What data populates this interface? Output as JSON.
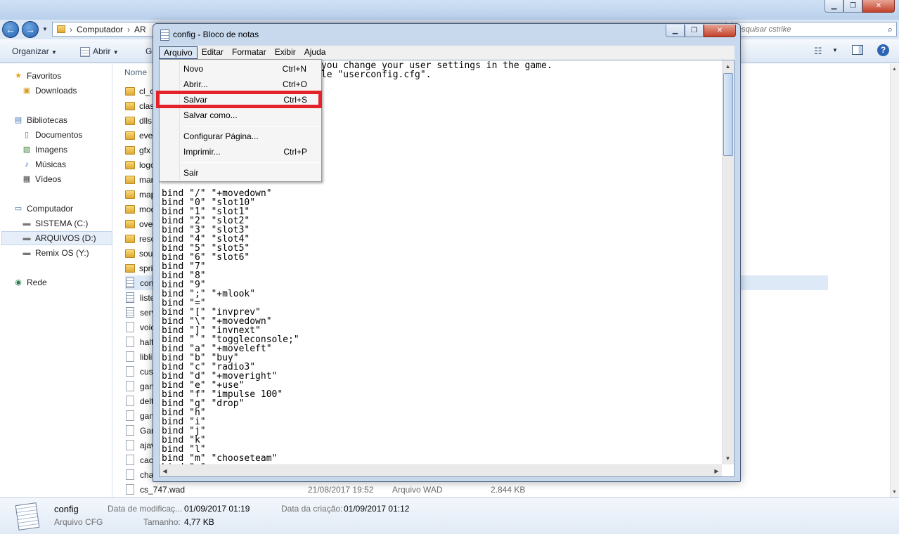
{
  "explorer": {
    "address": {
      "segments": [
        "Computador",
        "AR"
      ]
    },
    "search": {
      "placeholder": "esquisar cstrike"
    },
    "toolbar": {
      "organize": "Organizar",
      "open": "Abrir",
      "gr": "Gr"
    },
    "column_name": "Nome",
    "nav": {
      "favorites": "Favoritos",
      "downloads": "Downloads",
      "libraries": "Bibliotecas",
      "documents": "Documentos",
      "images": "Imagens",
      "music": "Músicas",
      "videos": "Vídeos",
      "computer": "Computador",
      "drive_c": "SISTEMA (C:)",
      "drive_d": "ARQUIVOS (D:)",
      "drive_y": "Remix OS (Y:)",
      "network": "Rede"
    },
    "files": [
      {
        "name": "cl_d",
        "kind": "folder"
      },
      {
        "name": "clas",
        "kind": "folder"
      },
      {
        "name": "dlls",
        "kind": "folder"
      },
      {
        "name": "even",
        "kind": "folder"
      },
      {
        "name": "gfx",
        "kind": "folder"
      },
      {
        "name": "logo",
        "kind": "folder"
      },
      {
        "name": "mar",
        "kind": "folder"
      },
      {
        "name": "map",
        "kind": "folder"
      },
      {
        "name": "mod",
        "kind": "folder"
      },
      {
        "name": "ove",
        "kind": "folder"
      },
      {
        "name": "reso",
        "kind": "folder"
      },
      {
        "name": "sou",
        "kind": "folder"
      },
      {
        "name": "spri",
        "kind": "folder"
      },
      {
        "name": "con",
        "kind": "cfg"
      },
      {
        "name": "liste",
        "kind": "cfg"
      },
      {
        "name": "serv",
        "kind": "cfg"
      },
      {
        "name": "voic",
        "kind": "file"
      },
      {
        "name": "half",
        "kind": "file"
      },
      {
        "name": "libli",
        "kind": "file"
      },
      {
        "name": "cust",
        "kind": "file"
      },
      {
        "name": "gam",
        "kind": "file"
      },
      {
        "name": "delt",
        "kind": "file"
      },
      {
        "name": "gam",
        "kind": "file"
      },
      {
        "name": "Gam",
        "kind": "file"
      },
      {
        "name": "ajav",
        "kind": "file"
      },
      {
        "name": "cach",
        "kind": "file"
      },
      {
        "name": "chat",
        "kind": "file"
      },
      {
        "name": "cs_747.wad",
        "kind": "file",
        "date": "21/08/2017 19:52",
        "type": "Arquivo WAD",
        "size": "2.844 KB"
      }
    ],
    "details": {
      "name": "config",
      "type": "Arquivo CFG",
      "modified_label": "Data de modificaç...",
      "modified": "01/09/2017 01:19",
      "created_label": "Data da criação:",
      "created": "01/09/2017 01:12",
      "size_label": "Tamanho:",
      "size": "4,77 KB"
    }
  },
  "notepad": {
    "title": "config - Bloco de notas",
    "menu": [
      "Arquivo",
      "Editar",
      "Formatar",
      "Exibir",
      "Ajuda"
    ],
    "text": "                    whenever you change your user settings in the game.\n                    to the file \"userconfig.cfg\".\n\n\n\n\n\n\n\n\n\n\n\n\nbind \"/\" \"+movedown\"\nbind \"0\" \"slot10\"\nbind \"1\" \"slot1\"\nbind \"2\" \"slot2\"\nbind \"3\" \"slot3\"\nbind \"4\" \"slot4\"\nbind \"5\" \"slot5\"\nbind \"6\" \"slot6\"\nbind \"7\"\nbind \"8\"\nbind \"9\"\nbind \";\" \"+mlook\"\nbind \"=\"\nbind \"[\" \"invprev\"\nbind \"\\\" \"+movedown\"\nbind \"]\" \"invnext\"\nbind \"`\" \"toggleconsole;\"\nbind \"a\" \"+moveleft\"\nbind \"b\" \"buy\"\nbind \"c\" \"radio3\"\nbind \"d\" \"+moveright\"\nbind \"e\" \"+use\"\nbind \"f\" \"impulse 100\"\nbind \"g\" \"drop\"\nbind \"h\"\nbind \"i\"\nbind \"j\"\nbind \"k\"\nbind \"l\"\nbind \"m\" \"chooseteam\"\nbind \"n\"",
    "file_menu": [
      {
        "label": "Novo",
        "shortcut": "Ctrl+N"
      },
      {
        "label": "Abrir...",
        "shortcut": "Ctrl+O"
      },
      {
        "label": "Salvar",
        "shortcut": "Ctrl+S"
      },
      {
        "label": "Salvar como...",
        "shortcut": ""
      },
      {
        "label": "Configurar Página...",
        "shortcut": ""
      },
      {
        "label": "Imprimir...",
        "shortcut": "Ctrl+P"
      },
      {
        "label": "Sair",
        "shortcut": ""
      }
    ]
  },
  "colors": {
    "highlight": "#e32229",
    "title_bar": "#c8d9ee"
  }
}
